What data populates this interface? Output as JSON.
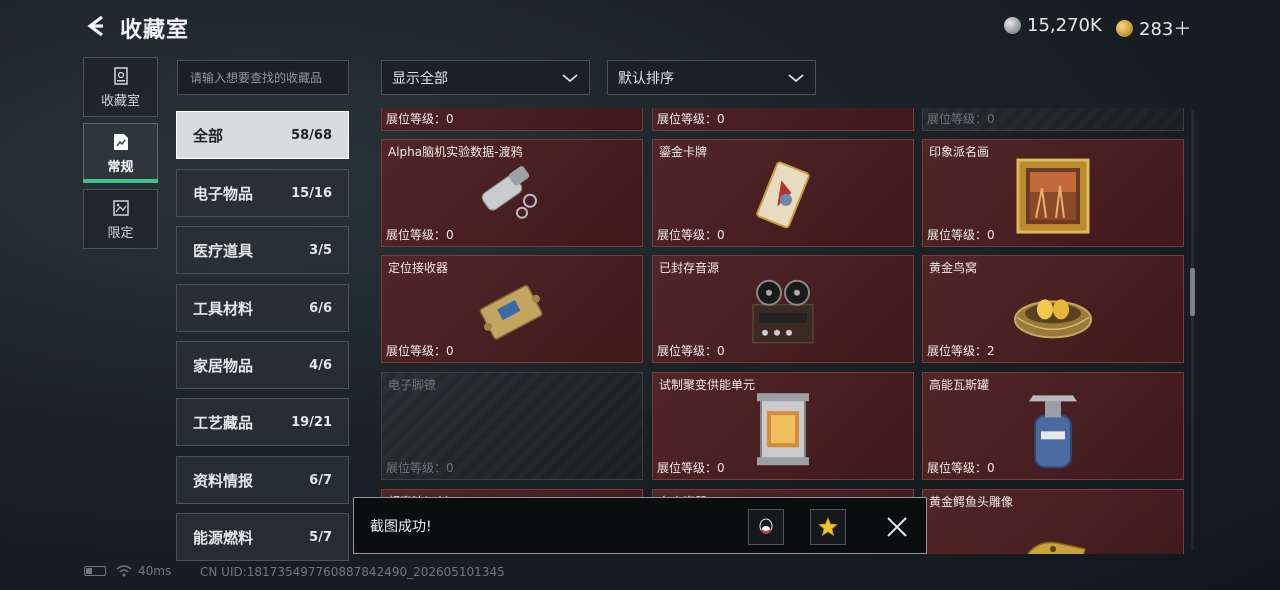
{
  "header": {
    "title": "收藏室",
    "currency_silver": "15,270K",
    "currency_gold": "283＋"
  },
  "nav": [
    {
      "label": "收藏室",
      "icon": "collection-room-icon"
    },
    {
      "label": "常规",
      "icon": "regular-icon"
    },
    {
      "label": "限定",
      "icon": "limited-icon"
    }
  ],
  "search": {
    "placeholder": "请输入想要查找的收藏品"
  },
  "filters": {
    "display": "显示全部",
    "sort": "默认排序"
  },
  "categories": [
    {
      "label": "全部",
      "count": "58/68"
    },
    {
      "label": "电子物品",
      "count": "15/16"
    },
    {
      "label": "医疗道具",
      "count": "3/5"
    },
    {
      "label": "工具材料",
      "count": "6/6"
    },
    {
      "label": "家居物品",
      "count": "4/6"
    },
    {
      "label": "工艺藏品",
      "count": "19/21"
    },
    {
      "label": "资料情报",
      "count": "6/7"
    },
    {
      "label": "能源燃料",
      "count": "5/7"
    }
  ],
  "level_prefix": "展位等级：",
  "cards": [
    {
      "name": "",
      "level": "展位等级：0",
      "icon": "partial-item-icon"
    },
    {
      "name": "",
      "level": "展位等级：0",
      "icon": "partial-item-icon"
    },
    {
      "name": "",
      "level": "展位等级：0",
      "icon": "partial-item-icon"
    },
    {
      "name": "Alpha脑机实验数据-渡鸦",
      "level": "展位等级：0",
      "icon": "data-drive-icon"
    },
    {
      "name": "鎏金卡牌",
      "level": "展位等级：0",
      "icon": "gilded-card-icon"
    },
    {
      "name": "印象派名画",
      "level": "展位等级：0",
      "icon": "framed-painting-icon"
    },
    {
      "name": "定位接收器",
      "level": "展位等级：0",
      "icon": "locator-receiver-icon"
    },
    {
      "name": "已封存音源",
      "level": "展位等级：0",
      "icon": "reel-recorder-icon"
    },
    {
      "name": "黄金鸟窝",
      "level": "展位等级：2",
      "icon": "golden-nest-icon"
    },
    {
      "name": "电子脚镣",
      "level": "展位等级：0",
      "icon": "ankle-monitor-icon"
    },
    {
      "name": "试制聚变供能单元",
      "level": "展位等级：0",
      "icon": "fusion-cell-icon"
    },
    {
      "name": "高能瓦斯罐",
      "level": "展位等级：0",
      "icon": "gas-canister-icon"
    },
    {
      "name": "超声波切割刀",
      "level": "",
      "icon": "ultrasonic-blade-icon"
    },
    {
      "name": "名窑瓷器",
      "level": "",
      "icon": "porcelain-icon"
    },
    {
      "name": "黄金鳄鱼头雕像",
      "level": "",
      "icon": "gold-croc-statue-icon"
    }
  ],
  "toast": {
    "message": "截图成功!",
    "qq_icon": "qq-share-icon",
    "qzone_icon": "qzone-share-icon"
  },
  "status": {
    "ping": "40ms",
    "uid": "CN UID:18173549776088784249​0_202605101345"
  }
}
